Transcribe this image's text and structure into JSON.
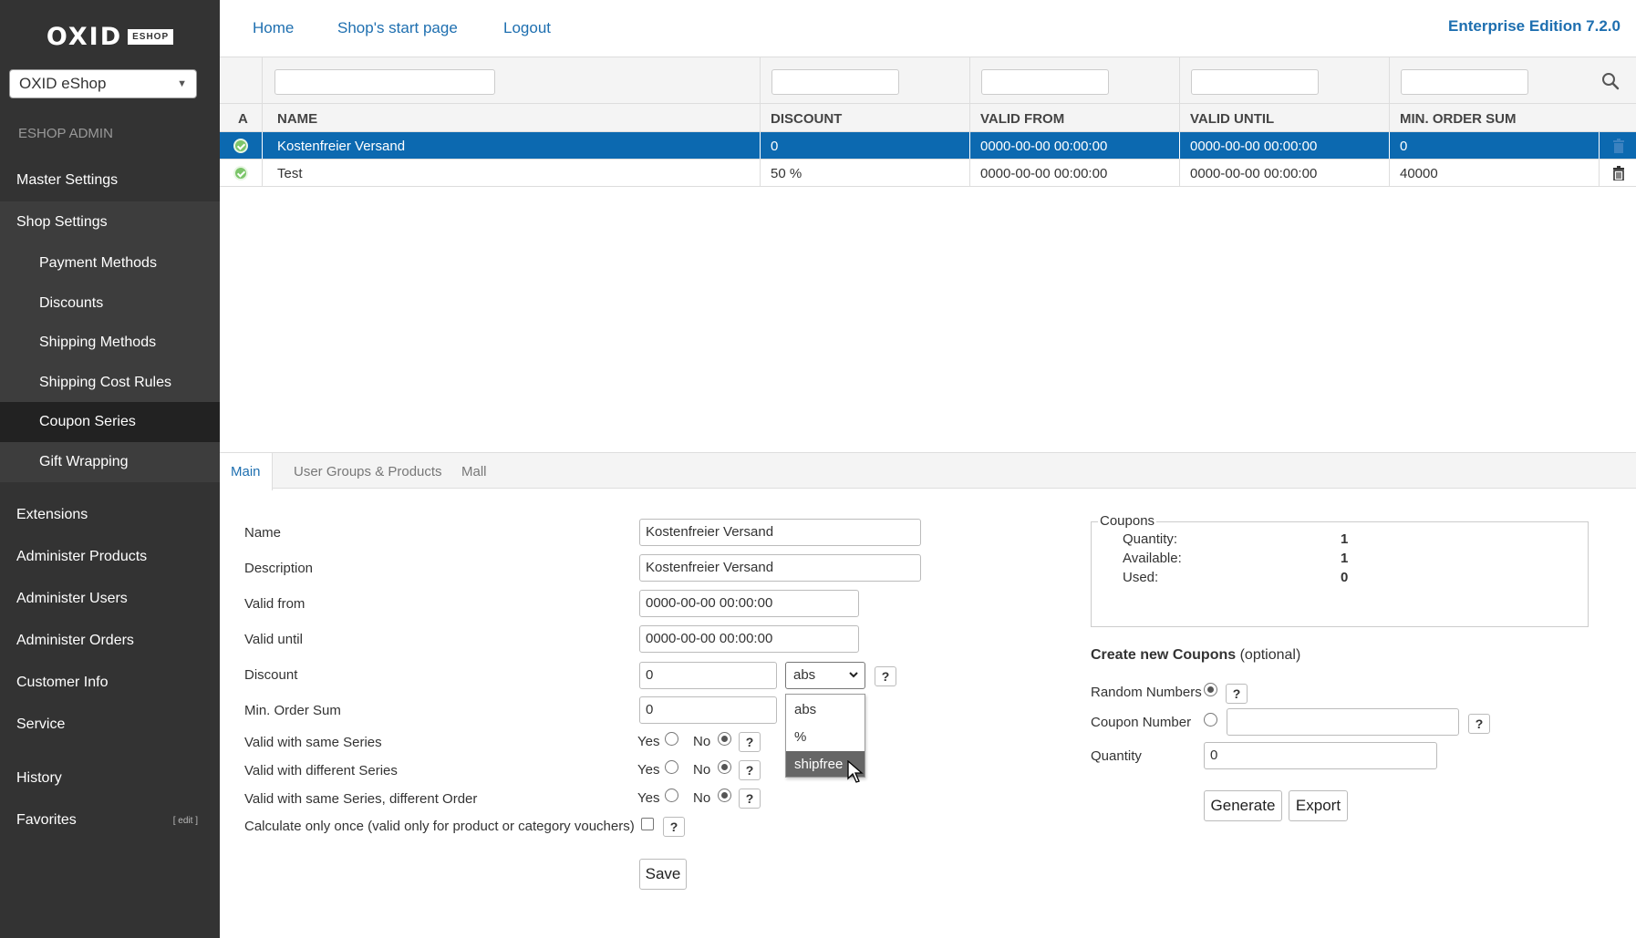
{
  "brand": {
    "logo_word": "OXID",
    "logo_box": "ESHOP"
  },
  "shop_selector": {
    "value": "OXID eShop"
  },
  "sidebar": {
    "section_label": "ESHOP ADMIN",
    "items": [
      {
        "label": "Master Settings"
      },
      {
        "label": "Shop Settings"
      },
      {
        "label": "Extensions"
      },
      {
        "label": "Administer Products"
      },
      {
        "label": "Administer Users"
      },
      {
        "label": "Administer Orders"
      },
      {
        "label": "Customer Info"
      },
      {
        "label": "Service"
      },
      {
        "label": "History"
      },
      {
        "label": "Favorites"
      }
    ],
    "shop_settings_sub": [
      {
        "label": "Payment Methods"
      },
      {
        "label": "Discounts"
      },
      {
        "label": "Shipping Methods"
      },
      {
        "label": "Shipping Cost Rules"
      },
      {
        "label": "Coupon Series"
      },
      {
        "label": "Gift Wrapping"
      }
    ],
    "favorites_edit": "[ edit ]"
  },
  "topbar": {
    "links": [
      {
        "label": "Home"
      },
      {
        "label": "Shop's start page"
      },
      {
        "label": "Logout"
      }
    ],
    "edition": "Enterprise Edition 7.2.0"
  },
  "list": {
    "columns": [
      "A",
      "NAME",
      "DISCOUNT",
      "VALID FROM",
      "VALID UNTIL",
      "MIN. ORDER SUM"
    ],
    "rows": [
      {
        "name": "Kostenfreier Versand",
        "discount": "0",
        "valid_from": "0000-00-00 00:00:00",
        "valid_until": "0000-00-00 00:00:00",
        "min_order_sum": "0",
        "selected": true
      },
      {
        "name": "Test",
        "discount": "50 %",
        "valid_from": "0000-00-00 00:00:00",
        "valid_until": "0000-00-00 00:00:00",
        "min_order_sum": "40000",
        "selected": false
      }
    ]
  },
  "tabs": [
    {
      "label": "Main"
    },
    {
      "label": "User Groups & Products"
    },
    {
      "label": "Mall"
    }
  ],
  "form": {
    "name_label": "Name",
    "name_value": "Kostenfreier Versand",
    "description_label": "Description",
    "description_value": "Kostenfreier Versand",
    "valid_from_label": "Valid from",
    "valid_from_value": "0000-00-00 00:00:00",
    "valid_until_label": "Valid until",
    "valid_until_value": "0000-00-00 00:00:00",
    "discount_label": "Discount",
    "discount_value": "0",
    "discount_type": "abs",
    "discount_type_options": [
      "abs",
      "%",
      "shipfree"
    ],
    "min_order_label": "Min. Order Sum",
    "min_order_value": "0",
    "same_series_label": "Valid with same Series",
    "different_series_label": "Valid with different Series",
    "same_series_diff_order_label": "Valid with same Series, different Order",
    "calc_once_label": "Calculate only once (valid only for product or category vouchers)",
    "yes": "Yes",
    "no": "No",
    "help": "?",
    "save": "Save"
  },
  "coupons": {
    "legend": "Coupons",
    "quantity_label": "Quantity:",
    "quantity_value": "1",
    "available_label": "Available:",
    "available_value": "1",
    "used_label": "Used:",
    "used_value": "0"
  },
  "create": {
    "title": "Create new Coupons",
    "optional": "(optional)",
    "random_label": "Random Numbers",
    "number_label": "Coupon Number",
    "number_value": "",
    "quantity_label": "Quantity",
    "quantity_value": "0",
    "generate": "Generate",
    "export": "Export"
  }
}
